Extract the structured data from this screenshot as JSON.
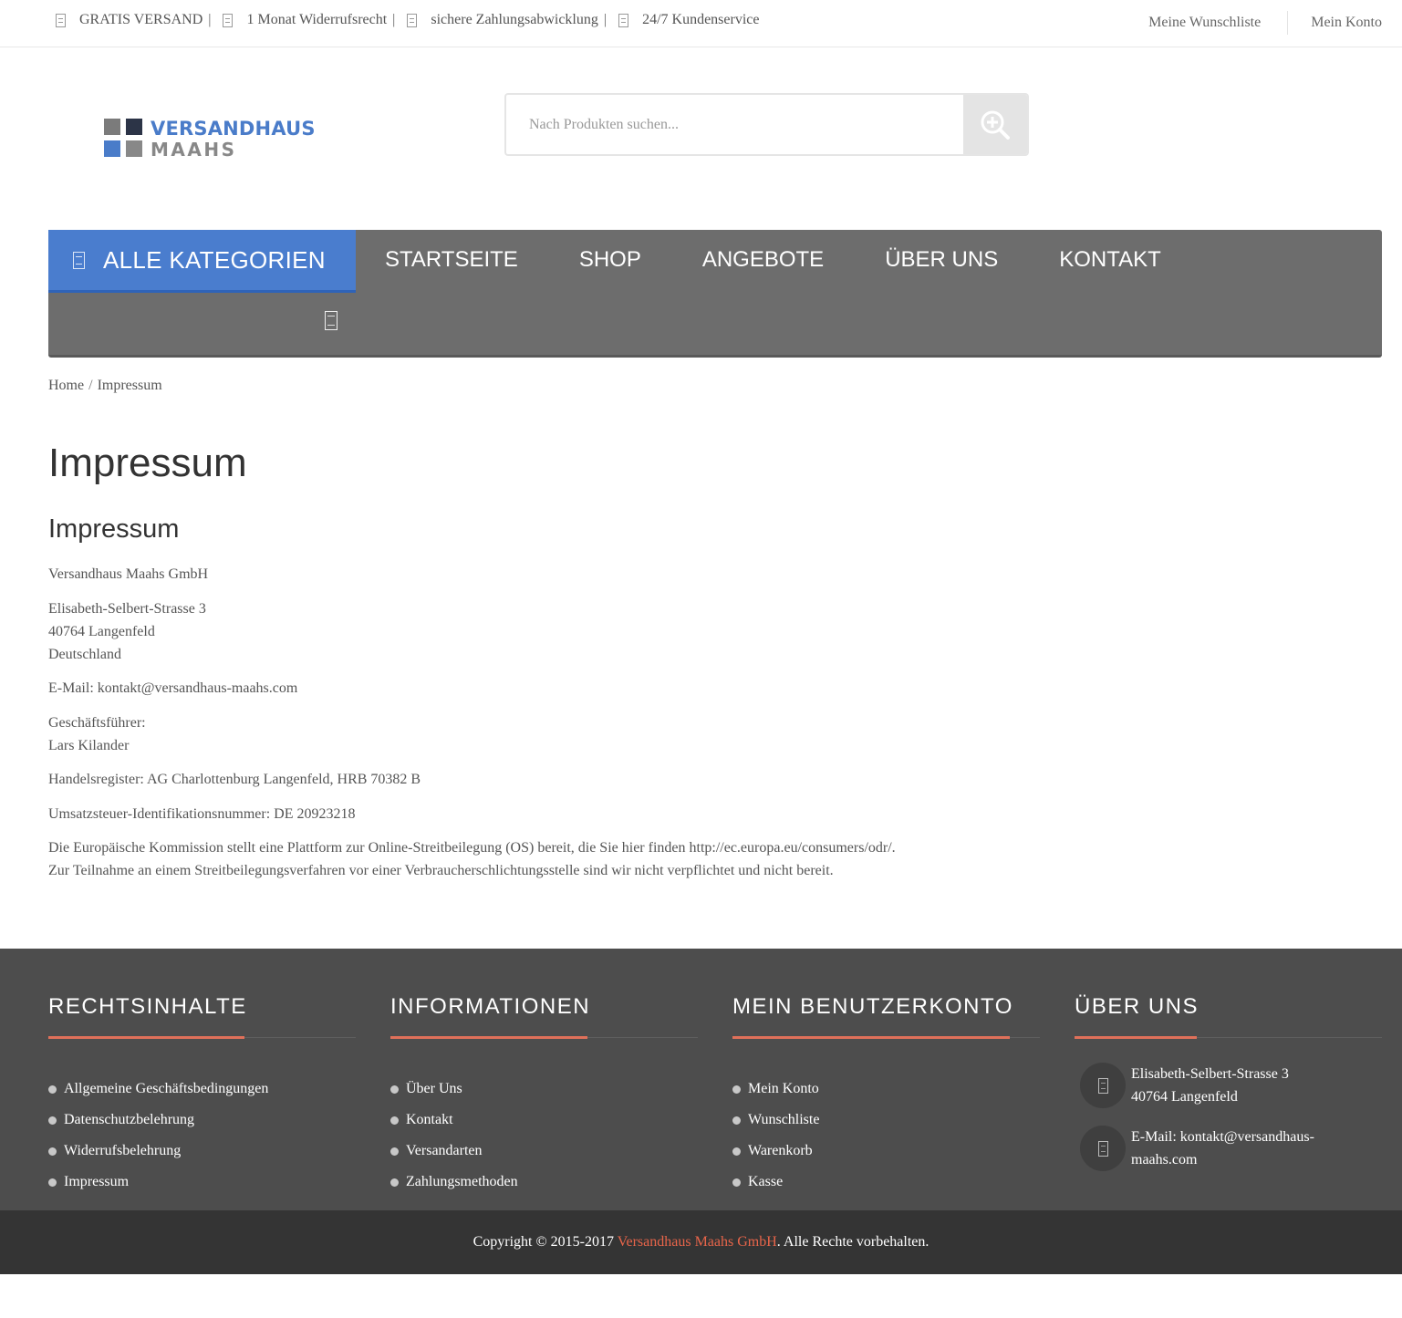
{
  "topbar": {
    "items": [
      {
        "label": "GRATIS VERSAND",
        "sep": "|"
      },
      {
        "label": "1 Monat Widerrufsrecht",
        "sep": "|"
      },
      {
        "label": "sichere Zahlungsabwicklung",
        "sep": "|"
      },
      {
        "label": "24/7 Kundenservice",
        "sep": ""
      }
    ],
    "wishlist": "Meine Wunschliste",
    "account": "Mein Konto"
  },
  "logo": {
    "line1": "VERSANDHAUS",
    "line2": "MAAHS"
  },
  "search": {
    "placeholder": "Nach Produkten suchen..."
  },
  "nav": {
    "categories": "ALLE KATEGORIEN",
    "links": [
      "STARTSEITE",
      "SHOP",
      "ANGEBOTE",
      "ÜBER UNS",
      "KONTAKT"
    ]
  },
  "breadcrumb": {
    "home": "Home",
    "separator": "/",
    "current": "Impressum"
  },
  "content": {
    "title": "Impressum",
    "subtitle": "Impressum",
    "company": "Versandhaus Maahs GmbH",
    "street": "Elisabeth-Selbert-Strasse 3",
    "city": "40764 Langenfeld",
    "country": "Deutschland",
    "email": "E-Mail: kontakt@versandhaus-maahs.com",
    "ceo_label": "Geschäftsführer:",
    "ceo_name": "Lars Kilander",
    "register": "Handelsregister: AG Charlottenburg Langenfeld, HRB 70382 B",
    "vat": "Umsatzsteuer-Identifikationsnummer: DE 20923218",
    "odr_1": "Die Europäische Kommission stellt eine Plattform zur Online-Streitbeilegung (OS) bereit, die Sie hier finden http://ec.europa.eu/consumers/odr/.",
    "odr_2": "Zur Teilnahme an einem Streitbeilegungsverfahren vor einer Verbraucherschlichtungsstelle sind wir nicht verpflichtet und nicht bereit."
  },
  "footer": {
    "legal": {
      "title": "RECHTSINHALTE",
      "items": [
        "Allgemeine Geschäftsbedingungen",
        "Datenschutzbelehrung",
        "Widerrufsbelehrung",
        "Impressum"
      ]
    },
    "info": {
      "title": "INFORMATIONEN",
      "items": [
        "Über Uns",
        "Kontakt",
        "Versandarten",
        "Zahlungsmethoden"
      ]
    },
    "account": {
      "title": "MEIN BENUTZERKONTO",
      "items": [
        "Mein Konto",
        "Wunschliste",
        "Warenkorb",
        "Kasse"
      ]
    },
    "about": {
      "title": "ÜBER UNS",
      "address_line1": "Elisabeth-Selbert-Strasse 3",
      "address_line2": "40764 Langenfeld",
      "email_line1": "E-Mail: kontakt@versandhaus-",
      "email_line2": "maahs.com"
    }
  },
  "copyright": {
    "prefix": "Copyright © 2015-2017 ",
    "brand": "Versandhaus Maahs GmbH",
    "suffix": ". Alle Rechte vorbehalten."
  },
  "colors": {
    "accent_blue": "#4a7dce",
    "nav_gray": "#6d6d6d",
    "footer_bg": "#4d4d4d",
    "footer_accent": "#e0705a",
    "copyright_bg": "#343434"
  }
}
